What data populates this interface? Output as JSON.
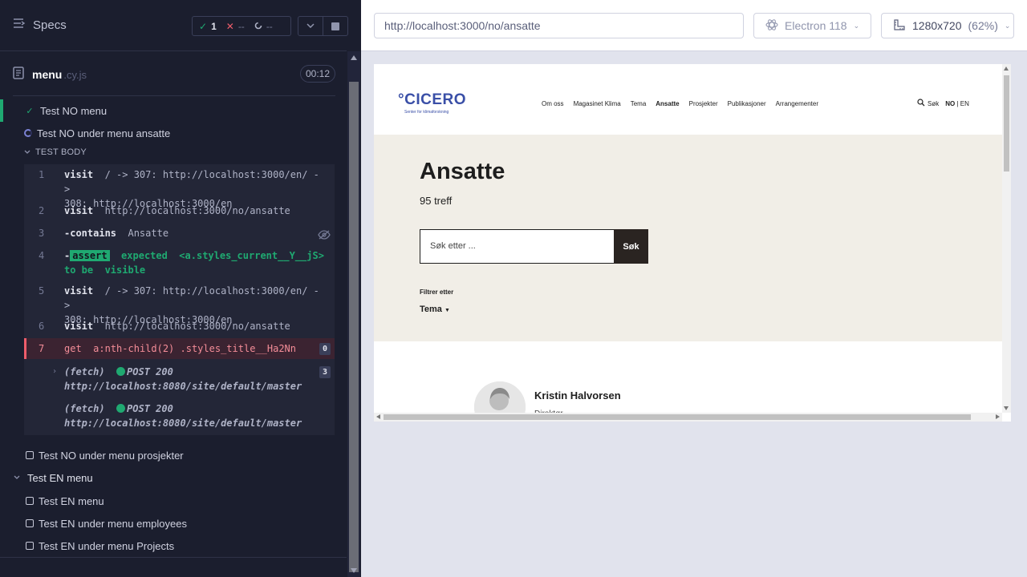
{
  "runner": {
    "title": "Specs",
    "stats": {
      "passed": "1",
      "failed": "--",
      "pending": "--"
    },
    "spec": {
      "name": "menu",
      "ext": ".cy.js",
      "duration": "00:12"
    },
    "tests": [
      {
        "label": "Test NO menu",
        "state": "passed"
      },
      {
        "label": "Test NO under menu ansatte",
        "state": "running"
      },
      {
        "label": "Test NO under menu prosjekter",
        "state": "pending"
      },
      {
        "label": "Test EN menu",
        "state": "suite"
      },
      {
        "label": "Test EN menu",
        "state": "pending"
      },
      {
        "label": "Test EN under menu employees",
        "state": "pending"
      },
      {
        "label": "Test EN under menu Projects",
        "state": "pending"
      }
    ],
    "test_body_label": "TEST BODY",
    "commands": [
      {
        "n": "1",
        "name": "visit",
        "line1": "/ -> 307: http://localhost:3000/en/ ->",
        "line2": "308: http://localhost:3000/en"
      },
      {
        "n": "2",
        "name": "visit",
        "line1": "http://localhost:3000/no/ansatte"
      },
      {
        "n": "3",
        "name": "-contains",
        "line1": "Ansatte"
      },
      {
        "n": "4",
        "prefix": "-",
        "badge": "assert",
        "word": "expected",
        "target": "<a.styles_current__Y__jS>",
        "tail1": "to be",
        "tail2": "visible"
      },
      {
        "n": "5",
        "name": "visit",
        "line1": "/ -> 307: http://localhost:3000/en/ ->",
        "line2": "308: http://localhost:3000/en"
      },
      {
        "n": "6",
        "name": "visit",
        "line1": "http://localhost:3000/no/ansatte"
      },
      {
        "n": "7",
        "name": "get",
        "line1": "a:nth-child(2) .styles_title__Ha2Nn",
        "count": "0"
      }
    ],
    "fetch_count": "3",
    "fetches": [
      {
        "label": "(fetch)",
        "method": "POST 200",
        "url": "http://localhost:8080/site/default/master"
      },
      {
        "label": "(fetch)",
        "method": "POST 200",
        "url": "http://localhost:8080/site/default/master"
      }
    ]
  },
  "preview": {
    "url": "http://localhost:3000/no/ansatte",
    "browser": "Electron 118",
    "viewport": "1280x720",
    "scale": "(62%)"
  },
  "site": {
    "logo_main": "°CICERO",
    "logo_sub": "Senter for klimaforskning",
    "nav": [
      "Om oss",
      "Magasinet Klima",
      "Tema",
      "Ansatte",
      "Prosjekter",
      "Publikasjoner",
      "Arrangementer"
    ],
    "active_nav": "Ansatte",
    "search_label": "Søk",
    "lang_no": "NO",
    "lang_sep": "|",
    "lang_en": "EN",
    "page_title": "Ansatte",
    "hits": "95 treff",
    "search_placeholder": "Søk etter ...",
    "search_button": "Søk",
    "filter_label": "Filtrer etter",
    "filter_tema": "Tema",
    "person_name": "Kristin Halvorsen",
    "person_role": "Direktør"
  },
  "colors": {
    "runner_bg": "#1b1e2e",
    "pass_green": "#1fa971",
    "fail_red": "#ee5d6b",
    "brand_blue": "#3a4fa7",
    "hero_bg": "#f1eee7"
  }
}
